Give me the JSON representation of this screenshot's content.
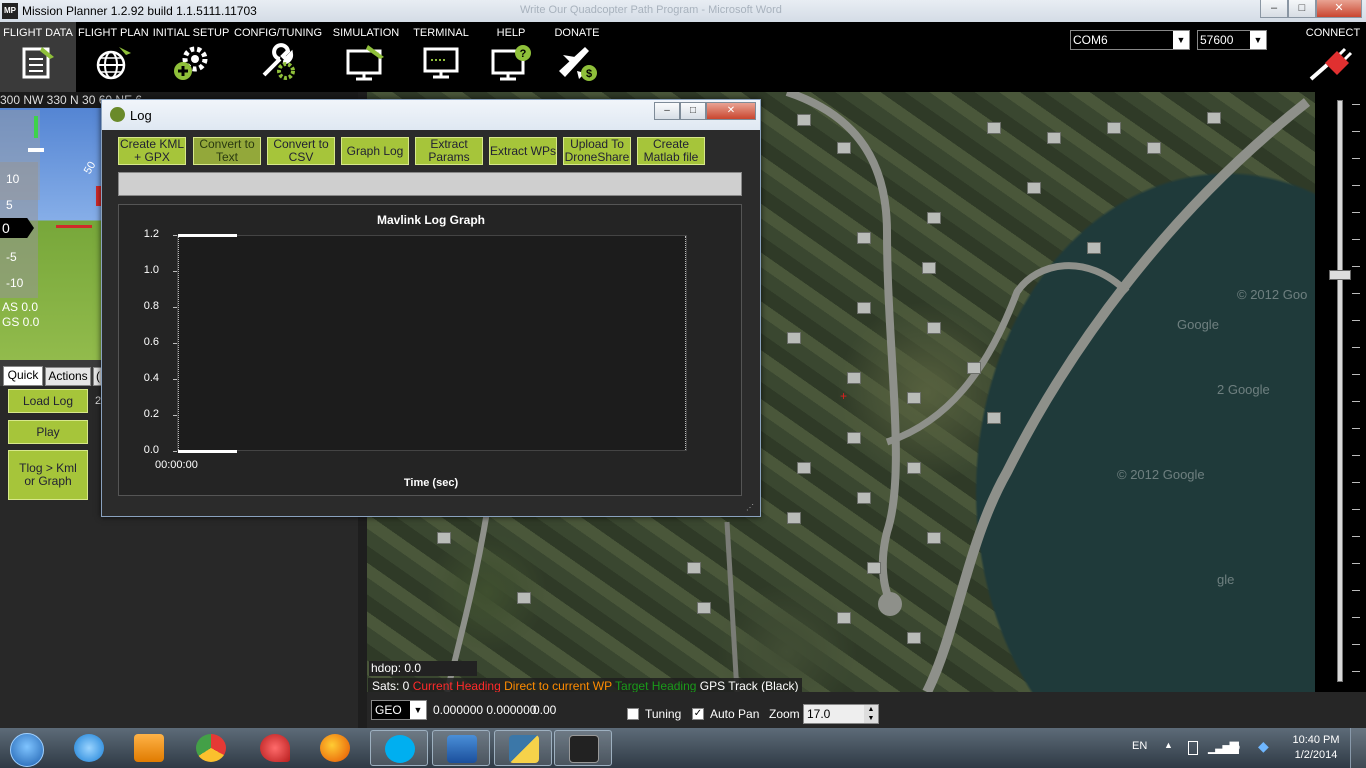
{
  "window": {
    "title": "Mission Planner 1.2.92 build 1.1.5111.11703",
    "background_title": "Write Our Quadcopter Path Program  -  Microsoft Word",
    "app_icon": "MP",
    "controls": [
      "–",
      "□",
      "✕"
    ]
  },
  "toolbar": {
    "items": [
      {
        "label": "FLIGHT DATA",
        "icon": "flight-data-icon"
      },
      {
        "label": "FLIGHT PLAN",
        "icon": "globe-icon"
      },
      {
        "label": "INITIAL SETUP",
        "icon": "setup-gear-icon"
      },
      {
        "label": "CONFIG/TUNING",
        "icon": "wrench-gear-icon"
      },
      {
        "label": "SIMULATION",
        "icon": "monitor-plane-icon"
      },
      {
        "label": "TERMINAL",
        "icon": "terminal-icon"
      },
      {
        "label": "HELP",
        "icon": "help-monitor-icon"
      },
      {
        "label": "DONATE",
        "icon": "donate-plane-icon"
      }
    ],
    "port": "COM6",
    "baud": "57600",
    "connect_label": "CONNECT"
  },
  "hud": {
    "compass": "300  NW  330   N   30   60   NE   6",
    "pitch_top": "50",
    "alt_labels": [
      "10",
      "5",
      "0",
      "-5",
      "-10"
    ],
    "airspeed": "AS 0.0",
    "groundspeed": "GS 0.0"
  },
  "tabs": {
    "quick": "Quick",
    "actions": "Actions",
    "more": "("
  },
  "quick_panel": {
    "load_log": "Load Log",
    "side_text": "2",
    "play": "Play",
    "tlog_kml": "Tlog > Kml or Graph"
  },
  "log_dialog": {
    "title": "Log",
    "buttons": [
      "Create KML + GPX",
      "Convert to Text",
      "Convert to CSV",
      "Graph Log",
      "Extract Params",
      "Extract WPs",
      "Upload To DroneShare",
      "Create Matlab file"
    ]
  },
  "chart_data": {
    "type": "line",
    "title": "Mavlink Log Graph",
    "xlabel": "Time (sec)",
    "ylabel": "",
    "x_tick_labels": [
      "00:00:00"
    ],
    "y_ticks": [
      "1.2",
      "1.0",
      "0.8",
      "0.6",
      "0.4",
      "0.2",
      "0.0"
    ],
    "ylim": [
      0,
      1.2
    ],
    "series": [
      {
        "values": [
          1.2,
          1.2
        ]
      },
      {
        "values": [
          0.0,
          0.0
        ]
      }
    ],
    "grid": false
  },
  "map": {
    "hdop": "hdop: 0.0",
    "legend": [
      {
        "text": "Sats: 0",
        "color": "#ffffff"
      },
      {
        "text": "Current Heading",
        "color": "#ff2a2a"
      },
      {
        "text": "Direct to current WP",
        "color": "#ff8c00"
      },
      {
        "text": "Target Heading",
        "color": "#1a9a1a"
      },
      {
        "text": "GPS Track (Black)",
        "color": "#ffffff"
      }
    ],
    "watermarks": [
      "© 2012 Goo",
      "Google",
      "2 Google",
      "© 2012 Google",
      "gle"
    ]
  },
  "map_bar": {
    "coord_mode": "GEO",
    "coords": "0.000000 0.000000",
    "alt": "0.00",
    "tuning_label": "Tuning",
    "tuning_checked": false,
    "autopan_label": "Auto Pan",
    "autopan_checked": true,
    "zoom_label": "Zoom",
    "zoom_value": "17.0"
  },
  "taskbar": {
    "apps": [
      {
        "name": "start-orb-icon"
      },
      {
        "name": "internet-explorer-icon"
      },
      {
        "name": "media-player-icon"
      },
      {
        "name": "chrome-icon"
      },
      {
        "name": "pushpin-app-icon"
      },
      {
        "name": "firefox-icon"
      },
      {
        "name": "skype-icon"
      },
      {
        "name": "word-icon"
      },
      {
        "name": "python-icon"
      },
      {
        "name": "mission-planner-icon"
      }
    ],
    "lang": "EN",
    "time": "10:40 PM",
    "date": "1/2/2014"
  }
}
